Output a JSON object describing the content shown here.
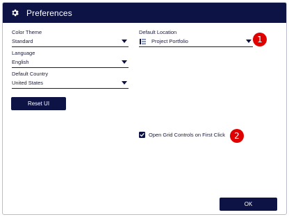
{
  "dialog": {
    "title": "Preferences",
    "title_icon": "gear-icon"
  },
  "fields": {
    "color_theme": {
      "label": "Color Theme",
      "value": "Standard"
    },
    "language": {
      "label": "Language",
      "value": "English"
    },
    "default_country": {
      "label": "Default Country",
      "value": "United States"
    },
    "default_location": {
      "label": "Default Location",
      "value": "Project Portfolio",
      "icon": "portfolio-icon"
    }
  },
  "buttons": {
    "reset_ui": "Reset UI",
    "ok": "OK"
  },
  "checkbox": {
    "label": "Open Grid Controls on First Click",
    "checked": true
  },
  "callouts": {
    "one": "1",
    "two": "2"
  },
  "colors": {
    "header_bg": "#0e1345",
    "callout_red": "#e00000"
  }
}
